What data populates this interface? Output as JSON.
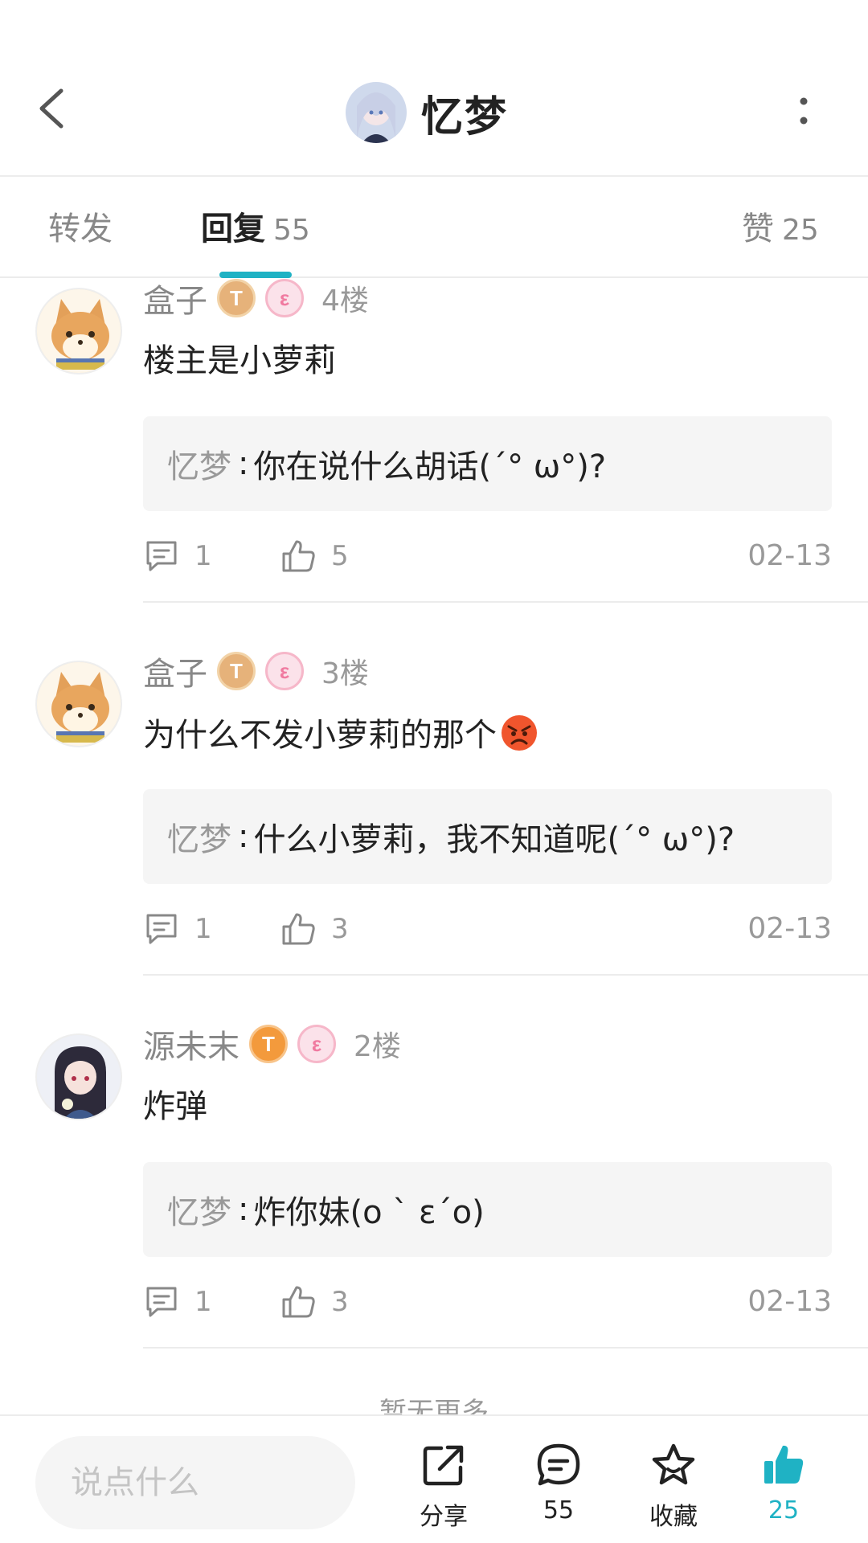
{
  "colors": {
    "accent": "#1fb2c4",
    "muted": "#999999",
    "text": "#222222"
  },
  "header": {
    "title": "忆梦",
    "back_icon": "chevron-left-icon",
    "more_icon": "more-vertical-icon"
  },
  "tabs": {
    "forward": {
      "label": "转发"
    },
    "reply": {
      "label": "回复",
      "count": "55"
    },
    "like": {
      "label": "赞",
      "count": "25"
    }
  },
  "comments": [
    {
      "name": "盒子",
      "badge_t": "T",
      "badge_e": "ε",
      "floor": "4楼",
      "text": "楼主是小萝莉",
      "reply": {
        "author": "忆梦",
        "colon": ":",
        "text": "你在说什么胡话(´° ω°)?"
      },
      "comment_count": "1",
      "like_count": "5",
      "date": "02-13"
    },
    {
      "name": "盒子",
      "badge_t": "T",
      "badge_e": "ε",
      "floor": "3楼",
      "text": "为什么不发小萝莉的那个",
      "emoji": "angry-face-icon",
      "reply": {
        "author": "忆梦",
        "colon": ":",
        "text": "什么小萝莉，我不知道呢(´° ω°)?"
      },
      "comment_count": "1",
      "like_count": "3",
      "date": "02-13"
    },
    {
      "name": "源未末",
      "badge_t": "T",
      "badge_e": "ε",
      "floor": "2楼",
      "text": "炸弹",
      "reply": {
        "author": "忆梦",
        "colon": ":",
        "text": "炸你妹(o ` ε´o)"
      },
      "comment_count": "1",
      "like_count": "3",
      "date": "02-13"
    }
  ],
  "footer_note": "暂无更多",
  "bottom_bar": {
    "input_placeholder": "说点什么",
    "share_label": "分享",
    "comment_count": "55",
    "favorite_label": "收藏",
    "like_count": "25"
  }
}
